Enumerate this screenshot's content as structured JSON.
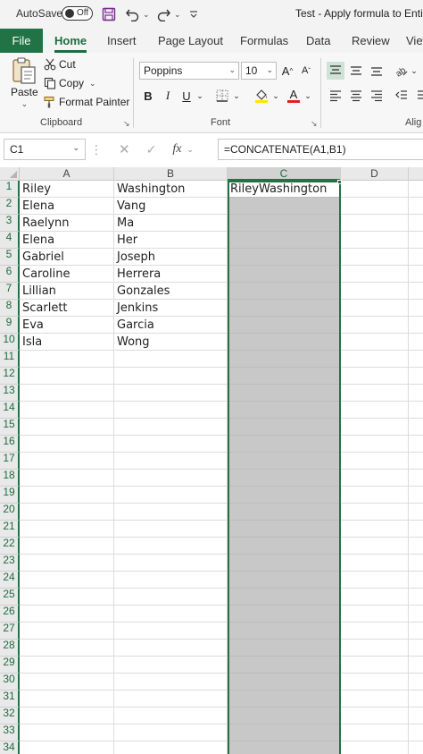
{
  "titlebar": {
    "autosave_label": "AutoSave",
    "autosave_state": "Off",
    "doc_title": "Test - Apply formula to Entire"
  },
  "tabs": [
    {
      "label": "File"
    },
    {
      "label": "Home"
    },
    {
      "label": "Insert"
    },
    {
      "label": "Page Layout"
    },
    {
      "label": "Formulas"
    },
    {
      "label": "Data"
    },
    {
      "label": "Review"
    },
    {
      "label": "View"
    }
  ],
  "ribbon": {
    "clipboard": {
      "paste": "Paste",
      "cut": "Cut",
      "copy": "Copy",
      "format_painter": "Format Painter",
      "group_label": "Clipboard"
    },
    "font": {
      "font_name": "Poppins",
      "font_size": "10",
      "bold": "B",
      "italic": "I",
      "underline": "U",
      "group_label": "Font"
    },
    "alignment": {
      "group_label": "Alig"
    }
  },
  "formula_bar": {
    "name_box": "C1",
    "formula": "=CONCATENATE(A1,B1)"
  },
  "grid": {
    "columns": [
      "A",
      "B",
      "C",
      "D"
    ],
    "selected_column": "C",
    "row_count": 34,
    "rows": [
      {
        "row": 1,
        "a": "Riley",
        "b": "Washington",
        "c": "RileyWashington"
      },
      {
        "row": 2,
        "a": "Elena",
        "b": "Vang",
        "c": ""
      },
      {
        "row": 3,
        "a": "Raelynn",
        "b": "Ma",
        "c": ""
      },
      {
        "row": 4,
        "a": "Elena",
        "b": "Her",
        "c": ""
      },
      {
        "row": 5,
        "a": "Gabriel",
        "b": "Joseph",
        "c": ""
      },
      {
        "row": 6,
        "a": "Caroline",
        "b": "Herrera",
        "c": ""
      },
      {
        "row": 7,
        "a": "Lillian",
        "b": "Gonzales",
        "c": ""
      },
      {
        "row": 8,
        "a": "Scarlett",
        "b": "Jenkins",
        "c": ""
      },
      {
        "row": 9,
        "a": "Eva",
        "b": "Garcia",
        "c": ""
      },
      {
        "row": 10,
        "a": "Isla",
        "b": "Wong",
        "c": ""
      }
    ]
  },
  "colors": {
    "excel_green": "#217346",
    "selection_fill": "#c8c8c8"
  }
}
